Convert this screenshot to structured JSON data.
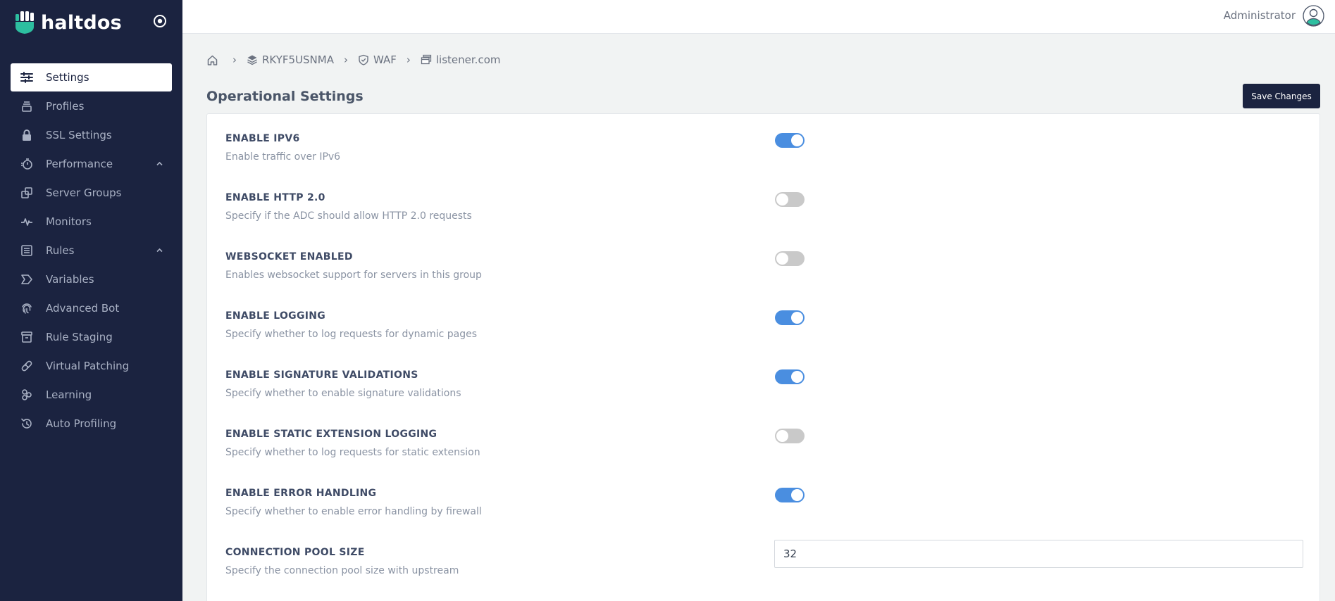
{
  "brand": {
    "name": "haltdos",
    "accent": "#2dbfa0"
  },
  "sidebar": {
    "items": [
      {
        "label": "Settings",
        "icon": "sliders-icon",
        "active": true
      },
      {
        "label": "Profiles",
        "icon": "stack-icon"
      },
      {
        "label": "SSL Settings",
        "icon": "lock-icon"
      },
      {
        "label": "Performance",
        "icon": "stopwatch-icon",
        "expandable": true
      },
      {
        "label": "Server Groups",
        "icon": "copy-icon"
      },
      {
        "label": "Monitors",
        "icon": "pulse-icon"
      },
      {
        "label": "Rules",
        "icon": "list-icon",
        "expandable": true
      },
      {
        "label": "Variables",
        "icon": "tag-icon"
      },
      {
        "label": "Advanced Bot",
        "icon": "fingerprint-icon"
      },
      {
        "label": "Rule Staging",
        "icon": "archive-icon"
      },
      {
        "label": "Virtual Patching",
        "icon": "bandage-icon"
      },
      {
        "label": "Learning",
        "icon": "nodes-icon"
      },
      {
        "label": "Auto Profiling",
        "icon": "history-icon"
      }
    ]
  },
  "topbar": {
    "user_name": "Administrator"
  },
  "breadcrumb": {
    "items": [
      "RKYF5USNMA",
      "WAF",
      "listener.com"
    ]
  },
  "page": {
    "title": "Operational Settings",
    "save_label": "Save Changes"
  },
  "settings": [
    {
      "title": "ENABLE IPV6",
      "desc": "Enable traffic over IPv6",
      "enabled": true
    },
    {
      "title": "ENABLE HTTP 2.0",
      "desc": "Specify if the ADC should allow HTTP 2.0 requests",
      "enabled": false
    },
    {
      "title": "WEBSOCKET ENABLED",
      "desc": "Enables websocket support for servers in this group",
      "enabled": false
    },
    {
      "title": "ENABLE LOGGING",
      "desc": "Specify whether to log requests for dynamic pages",
      "enabled": true
    },
    {
      "title": "ENABLE SIGNATURE VALIDATIONS",
      "desc": "Specify whether to enable signature validations",
      "enabled": true
    },
    {
      "title": "ENABLE STATIC EXTENSION LOGGING",
      "desc": "Specify whether to log requests for static extension",
      "enabled": false
    },
    {
      "title": "ENABLE ERROR HANDLING",
      "desc": "Specify whether to enable error handling by firewall",
      "enabled": true
    }
  ],
  "connection_pool": {
    "title": "CONNECTION POOL SIZE",
    "desc": "Specify the connection pool size with upstream",
    "value": "32"
  },
  "colors": {
    "sidebar_bg": "#1b2340",
    "toggle_on": "#4a8ee0",
    "toggle_off": "#c9c9c9"
  }
}
